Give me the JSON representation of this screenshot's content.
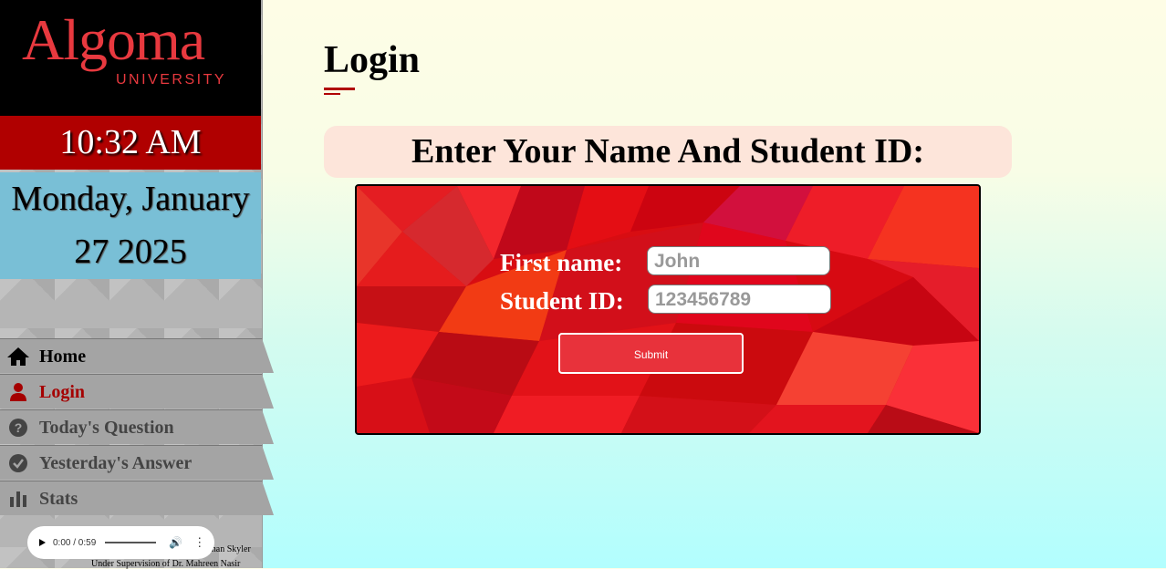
{
  "sidebar": {
    "logo": {
      "main": "Algoma",
      "sub": "UNIVERSITY"
    },
    "clock": "10:32 AM",
    "date_line1": "Monday, January",
    "date_line2": "27 2025",
    "nav": {
      "home": "Home",
      "login": "Login",
      "question": "Today's Question",
      "yesterday": "Yesterday's Answer",
      "stats": "Stats"
    },
    "audio": {
      "time": "0:00 / 0:59"
    },
    "credit1": "than Skyler",
    "credit2": "Under Supervision of Dr. Mahreen Nasir"
  },
  "main": {
    "title": "Login",
    "banner": "Enter Your Name And Student ID:",
    "form": {
      "first_name_label": "First name:",
      "first_name_placeholder": "John",
      "student_id_label": "Student ID:",
      "student_id_placeholder": "123456789",
      "submit_label": "Submit"
    }
  },
  "colors": {
    "accent_red": "#b00000",
    "date_blue": "#79bfd6",
    "banner_bg": "#fde5da",
    "panel_red": "#d80d12"
  }
}
